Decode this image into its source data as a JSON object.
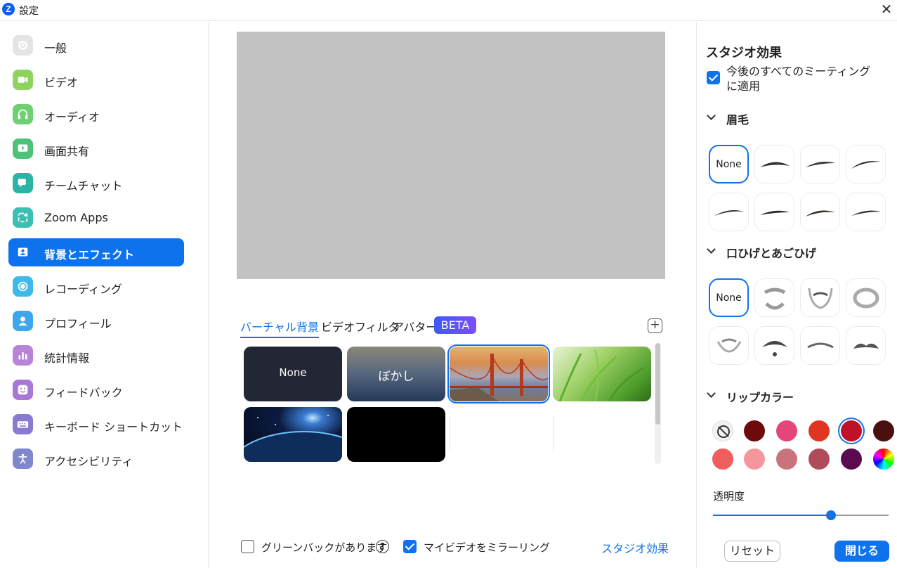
{
  "window": {
    "title": "設定",
    "logo_letter": "Z"
  },
  "sidebar": {
    "items": [
      {
        "label": "一般",
        "icon": "gear-icon",
        "color": "#e4e4e4"
      },
      {
        "label": "ビデオ",
        "icon": "video-camera-icon",
        "color": "#8fd35f"
      },
      {
        "label": "オーディオ",
        "icon": "headphones-icon",
        "color": "#6fcf73"
      },
      {
        "label": "画面共有",
        "icon": "share-screen-icon",
        "color": "#4fc27a"
      },
      {
        "label": "チームチャット",
        "icon": "chat-icon",
        "color": "#2bb3a3"
      },
      {
        "label": "Zoom Apps",
        "icon": "apps-icon",
        "color": "#3bbfb2"
      },
      {
        "label": "背景とエフェクト",
        "icon": "background-icon",
        "color": "#0e72ed"
      },
      {
        "label": "レコーディング",
        "icon": "record-icon",
        "color": "#3fb9ea"
      },
      {
        "label": "プロフィール",
        "icon": "profile-icon",
        "color": "#3ea6ec"
      },
      {
        "label": "統計情報",
        "icon": "statistics-icon",
        "color": "#b685d8"
      },
      {
        "label": "フィードバック",
        "icon": "feedback-icon",
        "color": "#a878d6"
      },
      {
        "label": "キーボード ショートカット",
        "icon": "keyboard-icon",
        "color": "#8c7ad2"
      },
      {
        "label": "アクセシビリティ",
        "icon": "accessibility-icon",
        "color": "#7f87cf"
      }
    ],
    "active_index": 6
  },
  "center": {
    "tabs": [
      {
        "label": "バーチャル背景",
        "active": true
      },
      {
        "label": "ビデオフィルタ",
        "active": false
      },
      {
        "label": "アバター",
        "active": false
      }
    ],
    "beta_badge": "BETA",
    "add_icon": "plus-icon",
    "backgrounds": [
      {
        "label": "None"
      },
      {
        "label": "ぼかし"
      },
      {
        "label": "",
        "selected": true
      },
      {
        "label": ""
      },
      {
        "label": ""
      },
      {
        "label": ""
      }
    ],
    "green_screen_label": "グリーンバックがあります",
    "green_screen_checked": false,
    "mirror_label": "マイビデオをミラーリング",
    "mirror_checked": true,
    "studio_link": "スタジオ効果"
  },
  "studio": {
    "title": "スタジオ効果",
    "apply_all_label": "今後のすべてのミーティングに適用",
    "apply_all_checked": true,
    "eyebrows_title": "眉毛",
    "eyebrows_none": "None",
    "mustache_title": "口ひげとあごひげ",
    "mustache_none": "None",
    "lip_title": "リップカラー",
    "lip_colors": [
      "none",
      "#6e0a0a",
      "#e4467a",
      "#e03520",
      "#c0112a",
      "#4a1010",
      "#ef5d5d",
      "#f5969c",
      "#c9737e",
      "#b04b5a",
      "#5a0a4e",
      "rainbow"
    ],
    "lip_selected_index": 4,
    "opacity_label": "透明度",
    "opacity_value": 0.67,
    "reset_label": "リセット",
    "close_label": "閉じる"
  }
}
